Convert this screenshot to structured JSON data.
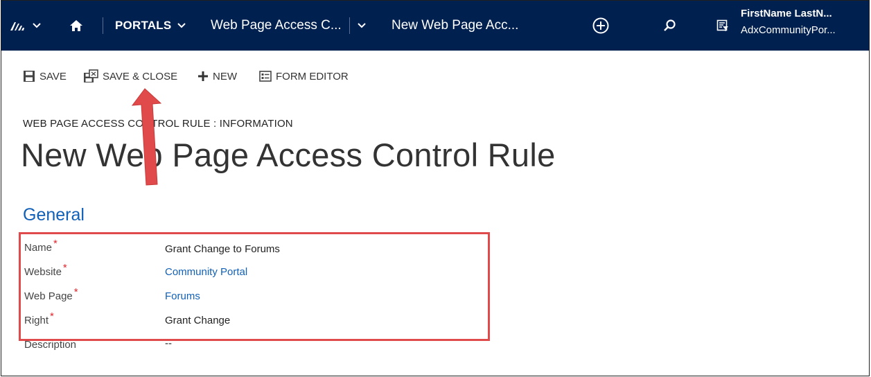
{
  "nav": {
    "section": "PORTALS",
    "entity_breadcrumb": "Web Page Access C...",
    "record_breadcrumb": "New Web Page Acc...",
    "user_name": "FirstName LastN...",
    "user_org": "AdxCommunityPor..."
  },
  "commands": {
    "save": "SAVE",
    "save_close": "SAVE & CLOSE",
    "new": "NEW",
    "form_editor": "FORM EDITOR"
  },
  "form": {
    "breadcrumb": "WEB PAGE ACCESS CONTROL RULE : INFORMATION",
    "title": "New Web Page Access Control Rule",
    "section": "General",
    "fields": [
      {
        "label": "Name",
        "required": "*",
        "value": "Grant Change to Forums"
      },
      {
        "label": "Website",
        "required": "*",
        "value": "Community Portal"
      },
      {
        "label": "Web Page",
        "required": "*",
        "value": "Forums"
      },
      {
        "label": "Right",
        "required": "*",
        "value": "Grant Change"
      },
      {
        "label": "Description",
        "required": "",
        "value": "--"
      }
    ]
  },
  "colors": {
    "navbar": "#002050",
    "link": "#1160b7",
    "required": "#e3262d",
    "annotation": "#e04a4a"
  },
  "icons": [
    "dynamics-logo-icon",
    "chevron-down-icon",
    "home-icon",
    "create-plus-icon",
    "search-icon",
    "advanced-find-icon",
    "save-icon",
    "save-close-icon",
    "plus-icon",
    "form-editor-icon"
  ]
}
